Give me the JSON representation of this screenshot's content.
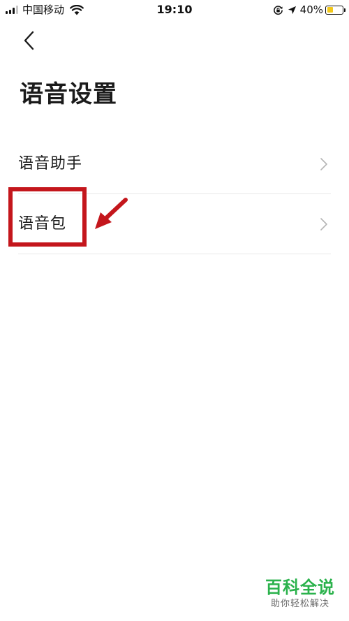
{
  "status_bar": {
    "carrier": "中国移动",
    "time": "19:10",
    "battery_percent": "40%",
    "battery_level": 0.4,
    "battery_color": "#f3c81a"
  },
  "nav": {
    "back_icon": "chevron-left-icon"
  },
  "page": {
    "title": "语音设置"
  },
  "settings": {
    "items": [
      {
        "label": "语音助手",
        "icon": "chevron-right-icon"
      },
      {
        "label": "语音包",
        "icon": "chevron-right-icon"
      }
    ]
  },
  "annotation": {
    "color": "#c4161c",
    "target": "语音包"
  },
  "watermark": {
    "title": "百科全说",
    "subtitle": "助你轻松解决",
    "color": "#2bb24c"
  }
}
